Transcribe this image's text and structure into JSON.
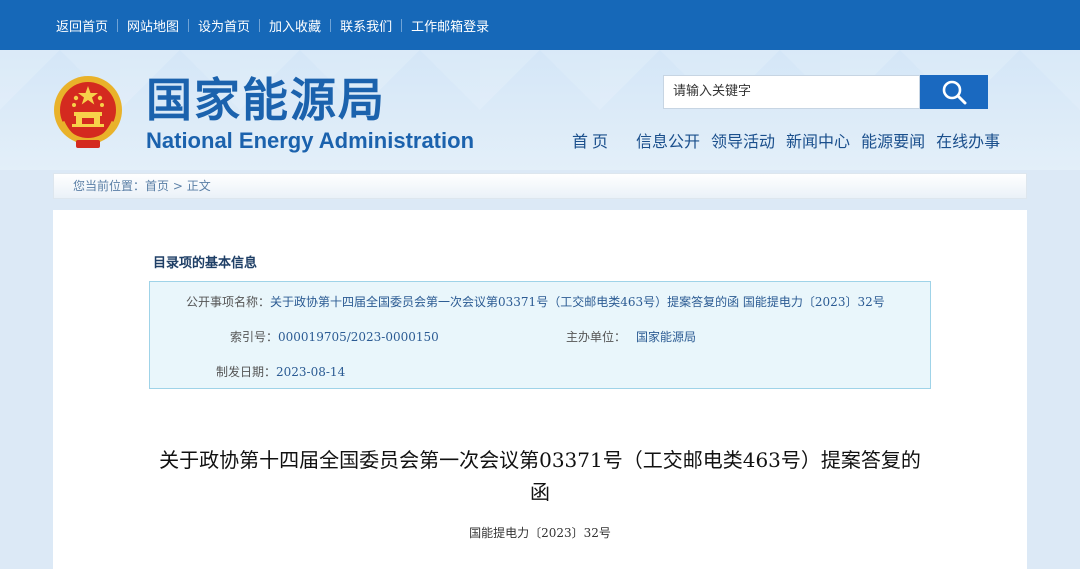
{
  "topbar": {
    "links": [
      "返回首页",
      "网站地图",
      "设为首页",
      "加入收藏",
      "联系我们",
      "工作邮箱登录"
    ]
  },
  "header": {
    "logo_cn": "国家能源局",
    "logo_en": "National Energy Administration",
    "search_placeholder": "请输入关键字",
    "nav": [
      "首页",
      "信息公开",
      "领导活动",
      "新闻中心",
      "能源要闻",
      "在线办事"
    ]
  },
  "breadcrumb": {
    "prefix": "您当前位置：",
    "home": "首页",
    "separator": ">",
    "current": "正文"
  },
  "info": {
    "section_title": "目录项的基本信息",
    "public_item_label": "公开事项名称：",
    "public_item_value": "关于政协第十四届全国委员会第一次会议第03371号（工交邮电类463号）提案答复的函 国能提电力〔2023〕32号",
    "index_label": "索引号：",
    "index_value": "000019705/2023-0000150",
    "organizer_label": "主办单位：",
    "organizer_value": "国家能源局",
    "date_label": "制发日期：",
    "date_value": "2023-08-14"
  },
  "article": {
    "title": "关于政协第十四届全国委员会第一次会议第03371号（工交邮电类463号）提案答复的函",
    "doc_number": "国能提电力〔2023〕32号"
  },
  "icons": {
    "emblem": "national-emblem-icon",
    "search": "search-icon"
  },
  "colors": {
    "topbar": "#1668b8",
    "brand_blue": "#1b62ad",
    "search_button": "#1a69c0",
    "info_box_bg": "#e9f6fb",
    "info_box_border": "#9fd3e8"
  }
}
